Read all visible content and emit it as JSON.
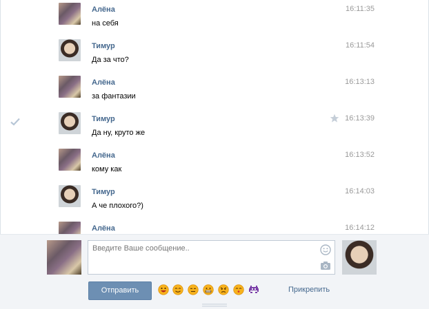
{
  "chat": {
    "messages": [
      {
        "author": "Алёна",
        "text": "на себя",
        "time": "16:11:35",
        "avatar": "alena",
        "checked": false,
        "starred": false
      },
      {
        "author": "Тимур",
        "text": "Да за что?",
        "time": "16:11:54",
        "avatar": "timur",
        "checked": false,
        "starred": false
      },
      {
        "author": "Алёна",
        "text": "за фантазии",
        "time": "16:13:13",
        "avatar": "alena",
        "checked": false,
        "starred": false
      },
      {
        "author": "Тимур",
        "text": "Да ну, круто же",
        "time": "16:13:39",
        "avatar": "timur",
        "checked": true,
        "starred": true
      },
      {
        "author": "Алёна",
        "text": "кому как",
        "time": "16:13:52",
        "avatar": "alena",
        "checked": false,
        "starred": false
      },
      {
        "author": "Тимур",
        "text": "А че плохого?)",
        "time": "16:14:03",
        "avatar": "timur",
        "checked": false,
        "starred": false
      },
      {
        "author": "Алёна",
        "text": "",
        "time": "16:14:12",
        "avatar": "alena",
        "checked": false,
        "starred": false
      }
    ]
  },
  "composer": {
    "placeholder": "Введите Ваше сообщение..",
    "value": "",
    "send_label": "Отправить",
    "attach_label": "Прикрепить",
    "emojis": [
      "grin-emoji",
      "smile-emoji",
      "neutral-emoji",
      "grimace-emoji",
      "angry-emoji",
      "kiss-emoji",
      "space-invader-emoji"
    ]
  },
  "colors": {
    "author": "#45688e",
    "time": "#999999",
    "send_button": "#6d8fb3",
    "composer_bg": "#f2f4f7"
  }
}
